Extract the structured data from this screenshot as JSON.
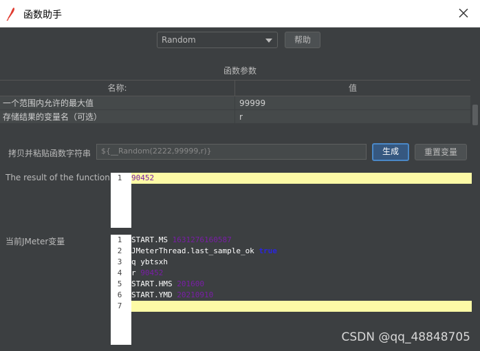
{
  "window": {
    "title": "函数助手"
  },
  "function_select": {
    "value": "Random"
  },
  "help_button": "帮助",
  "section_title": "函数参数",
  "table": {
    "headers": [
      "名称:",
      "值"
    ],
    "rows": [
      {
        "name": "一个范围内允许的最大值",
        "value": "99999"
      },
      {
        "name": "存储结果的变量名（可选）",
        "value": "r"
      }
    ]
  },
  "copy_label": "拷贝并粘贴函数字符串",
  "function_string": "${__Random(2222,99999,r)}",
  "generate_button": "生成",
  "reset_button": "重置变量",
  "result_label": "The result of the function is",
  "result_lines": [
    {
      "num": "1",
      "text": "90452"
    }
  ],
  "vars_label": "当前JMeter变量",
  "vars_lines": [
    {
      "num": "1",
      "key": "START.MS",
      "val": "1631276160587"
    },
    {
      "num": "2",
      "key": "JMeterThread.last_sample_ok",
      "val": "true"
    },
    {
      "num": "3",
      "key": "q",
      "val": "ybtsxh"
    },
    {
      "num": "4",
      "key": "r",
      "val": "90452"
    },
    {
      "num": "5",
      "key": "START.HMS",
      "val": "201600"
    },
    {
      "num": "6",
      "key": "START.YMD",
      "val": "20210910"
    },
    {
      "num": "7",
      "key": "",
      "val": ""
    }
  ],
  "watermark": "CSDN @qq_48848705"
}
